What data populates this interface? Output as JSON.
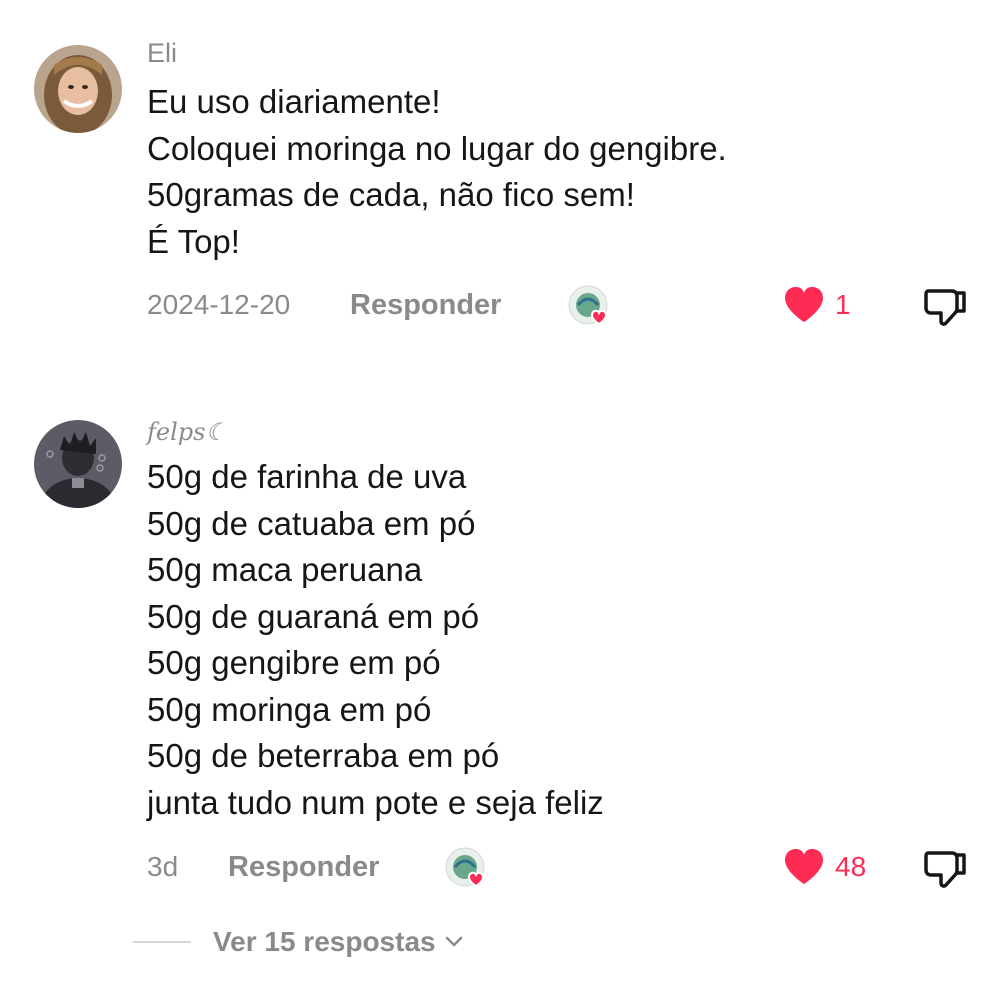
{
  "comments": [
    {
      "username": "Eli",
      "lines": [
        "Eu uso diariamente!",
        "Coloquei moringa no lugar do gengibre.",
        "50gramas de cada, não fico sem!",
        "É Top!"
      ],
      "date": "2024-12-20",
      "reply_label": "Responder",
      "like_count": "1",
      "liked": true
    },
    {
      "username": "felps☾",
      "lines": [
        "50g de farinha de uva",
        "50g de catuaba em pó",
        "50g maca peruana",
        "50g de guaraná em pó",
        "50g gengibre em pó",
        "50g moringa em pó",
        "50g de beterraba em pó",
        "junta tudo num pote e seja feliz"
      ],
      "date": "3d",
      "reply_label": "Responder",
      "like_count": "48",
      "liked": true
    }
  ],
  "replies_toggle": {
    "label": "Ver 15 respostas",
    "icon": "chevron-down-icon"
  },
  "colors": {
    "like": "#fe2c55",
    "muted": "#8a8a8a",
    "text": "#161616"
  }
}
